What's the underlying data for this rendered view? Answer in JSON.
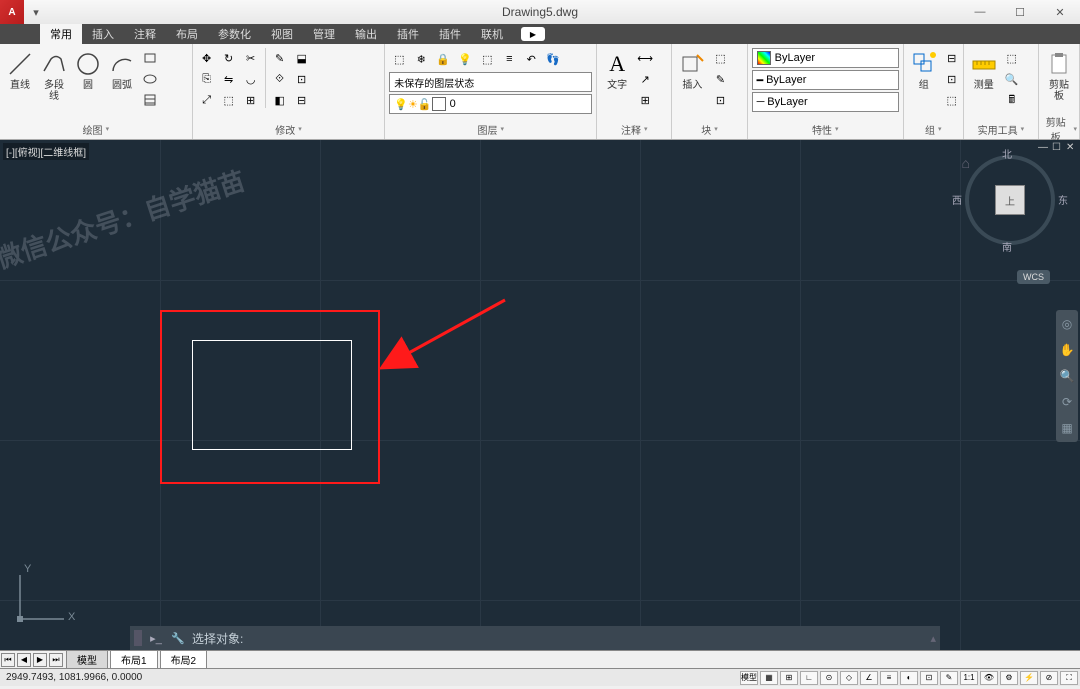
{
  "title": "Drawing5.dwg",
  "app_icon": "A",
  "menu": {
    "tabs": [
      "常用",
      "插入",
      "注释",
      "布局",
      "参数化",
      "视图",
      "管理",
      "输出",
      "插件",
      "插件",
      "联机"
    ],
    "active": 0
  },
  "ribbon": {
    "draw": {
      "title": "绘图",
      "line": "直线",
      "polyline": "多段线",
      "circle": "圆",
      "arc": "圆弧"
    },
    "modify": {
      "title": "修改"
    },
    "layer": {
      "title": "图层",
      "state": "未保存的图层状态",
      "current": "0"
    },
    "annotation": {
      "title": "注释",
      "text": "文字"
    },
    "block": {
      "title": "块",
      "insert": "插入"
    },
    "properties": {
      "title": "特性",
      "bylayer": "ByLayer",
      "bylayer2": "ByLayer",
      "bylayer3": "ByLayer"
    },
    "group": {
      "title": "组",
      "label": "组"
    },
    "utilities": {
      "title": "实用工具",
      "measure": "测量"
    },
    "clipboard": {
      "title": "剪贴板",
      "label": "剪贴板"
    }
  },
  "viewport": {
    "label": "[-][俯视][二维线框]"
  },
  "viewcube": {
    "top": "上",
    "n": "北",
    "s": "南",
    "e": "东",
    "w": "西",
    "wcs": "WCS"
  },
  "ucs": {
    "x": "X",
    "y": "Y"
  },
  "command": {
    "prompt": "选择对象:"
  },
  "tabs": {
    "model": "模型",
    "layout1": "布局1",
    "layout2": "布局2"
  },
  "status": {
    "coords": "2949.7493, 1081.9966, 0.0000",
    "model": "模型",
    "scale": "1:1"
  },
  "watermark": "微信公众号：自学猫苗"
}
